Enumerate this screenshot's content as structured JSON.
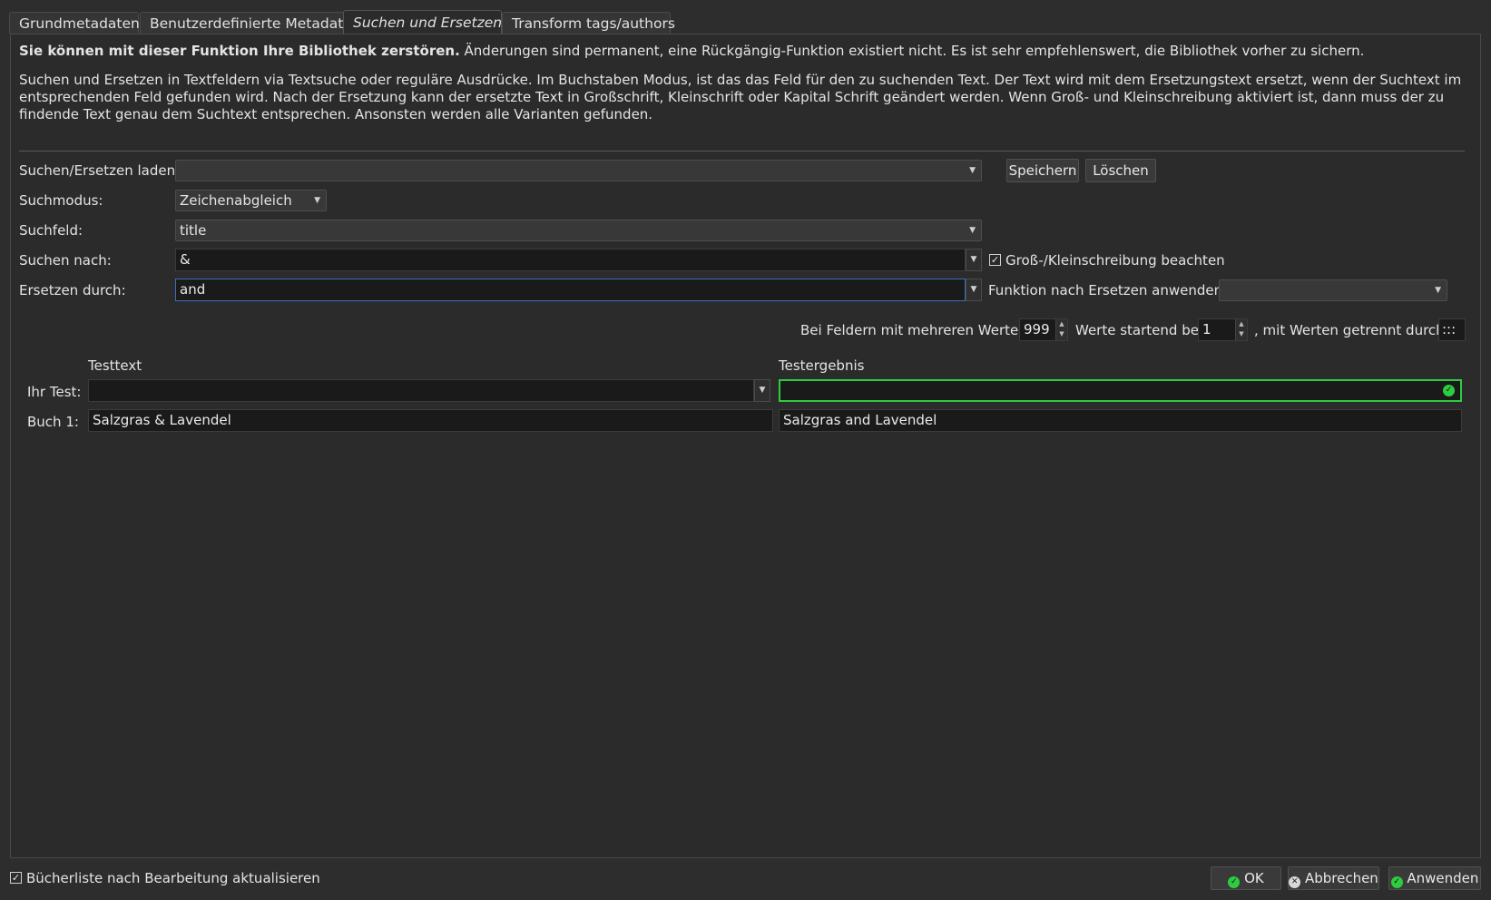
{
  "tabs": [
    {
      "label": "Grundmetadaten",
      "active": false
    },
    {
      "label": "Benutzerdefinierte Metadaten",
      "active": false
    },
    {
      "label": "Suchen und Ersetzen",
      "active": true
    },
    {
      "label": "Transform tags/authors",
      "active": false
    }
  ],
  "warning": {
    "bold": "Sie können mit dieser Funktion Ihre Bibliothek zerstören.",
    "rest": " Änderungen sind permanent, eine Rückgängig-Funktion existiert nicht. Es ist sehr empfehlenswert, die Bibliothek vorher zu sichern."
  },
  "description": "Suchen und Ersetzen in Textfeldern via Textsuche oder reguläre Ausdrücke. Im Buchstaben Modus, ist das das Feld für den zu suchenden Text. Der Text wird mit dem Ersetzungstext ersetzt, wenn der Suchtext im entsprechenden Feld gefunden wird. Nach der Ersetzung kann der ersetzte Text in Großschrift, Kleinschrift oder Kapital Schrift geändert werden. Wenn Groß- und Kleinschreibung aktiviert ist, dann muss der zu findende Text genau dem Suchtext entsprechen. Ansonsten werden alle Varianten gefunden.",
  "form": {
    "load_label": "Suchen/Ersetzen laden:",
    "load_value": "",
    "save_button": "Speichern",
    "delete_button": "Löschen",
    "mode_label": "Suchmodus:",
    "mode_value": "Zeichenabgleich",
    "field_label": "Suchfeld:",
    "field_value": "title",
    "search_label": "Suchen nach:",
    "search_value": "&",
    "case_label": "Groß-/Kleinschreibung beachten",
    "case_checked": true,
    "replace_label": "Ersetzen durch:",
    "replace_value": "and",
    "func_label": "Funktion nach Ersetzen anwenden:",
    "func_value": ""
  },
  "multi": {
    "prefix": "Bei Feldern mit mehreren Werten",
    "count": "999",
    "middle": "Werte startend bei",
    "start": "1",
    "suffix": ", mit Werten getrennt durch",
    "separator": ":::"
  },
  "test": {
    "col_text": "Testtext",
    "col_result": "Testergebnis",
    "your_test_label": "Ihr Test:",
    "your_test_value": "",
    "book_label": "Buch 1:",
    "book_text": "Salzgras & Lavendel",
    "book_result": "Salzgras and Lavendel"
  },
  "footer": {
    "refresh_label": "Bücherliste nach Bearbeitung aktualisieren",
    "refresh_checked": true,
    "ok": "OK",
    "cancel": "Abbrechen",
    "apply": "Anwenden"
  }
}
